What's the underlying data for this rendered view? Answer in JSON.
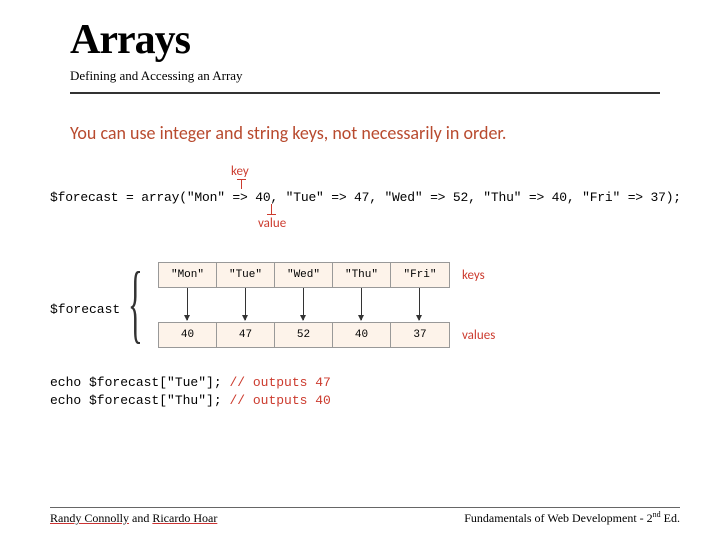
{
  "header": {
    "title": "Arrays",
    "subtitle": "Defining and Accessing an Array"
  },
  "body": {
    "lead": "You can use integer and string keys, not necessarily in order."
  },
  "diagram": {
    "key_label": "key",
    "value_label": "value",
    "code_line": "$forecast = array(\"Mon\" => 40, \"Tue\" => 47, \"Wed\" => 52, \"Thu\" => 40, \"Fri\" => 37);",
    "forecast_var": "$forecast",
    "keys_label": "keys",
    "values_label": "values",
    "keys": [
      "\"Mon\"",
      "\"Tue\"",
      "\"Wed\"",
      "\"Thu\"",
      "\"Fri\""
    ],
    "values": [
      "40",
      "47",
      "52",
      "40",
      "37"
    ],
    "echo1_code": "echo $forecast[\"Tue\"];  ",
    "echo1_comment": "// outputs 47",
    "echo2_code": "echo $forecast[\"Thu\"];  ",
    "echo2_comment": "// outputs 40"
  },
  "footer": {
    "author1": "Randy Connolly",
    "and": " and ",
    "author2": "Ricardo Hoar",
    "right_a": "Fundamentals of Web Development - 2",
    "right_sup": "nd",
    "right_b": " Ed."
  }
}
